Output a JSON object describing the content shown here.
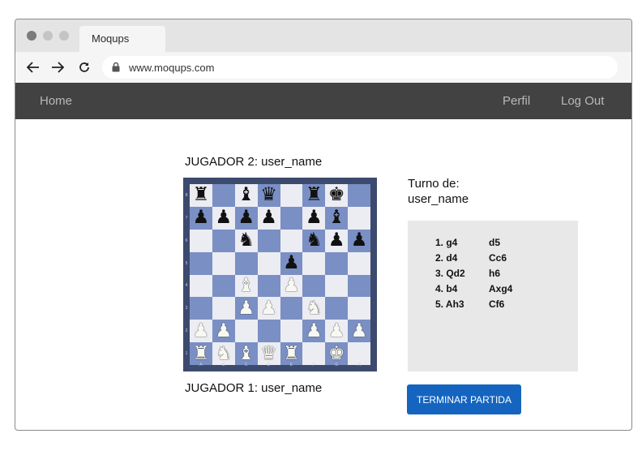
{
  "browser": {
    "tab_title": "Moqups",
    "url": "www.moqups.com",
    "icons": [
      "back-arrow-icon",
      "forward-arrow-icon",
      "reload-icon",
      "lock-icon"
    ]
  },
  "nav": {
    "home": "Home",
    "perfil": "Perfil",
    "logout": "Log Out"
  },
  "game": {
    "player2": "JUGADOR 2: user_name",
    "player1": "JUGADOR 1: user_name",
    "turn_label": "Turno de:",
    "turn_user": "user_name",
    "end_button": "TERMINAR PARTIDA",
    "board_files": [
      "A",
      "B",
      "C",
      "D",
      "E",
      "F",
      "G",
      "H"
    ],
    "board_ranks": [
      "8",
      "7",
      "6",
      "5",
      "4",
      "3",
      "2",
      "1"
    ],
    "board": [
      [
        "r",
        "",
        "b",
        "q",
        "",
        "r",
        "k",
        ""
      ],
      [
        "p",
        "p",
        "p",
        "p",
        "",
        "p",
        "b",
        ""
      ],
      [
        "",
        "",
        "n",
        "",
        "",
        "n",
        "p",
        "p"
      ],
      [
        "",
        "",
        "",
        "",
        "p",
        "",
        "",
        ""
      ],
      [
        "",
        "",
        "B",
        "",
        "P",
        "",
        "",
        ""
      ],
      [
        "",
        "",
        "P",
        "P",
        "",
        "N",
        "",
        ""
      ],
      [
        "P",
        "P",
        "",
        "",
        "",
        "P",
        "P",
        "P"
      ],
      [
        "R",
        "N",
        "B",
        "Q",
        "R",
        "",
        "K",
        ""
      ]
    ],
    "moves": [
      {
        "white": "1. g4",
        "black": "d5"
      },
      {
        "white": "2. d4",
        "black": "Cc6"
      },
      {
        "white": "3. Qd2",
        "black": "h6"
      },
      {
        "white": "4. b4",
        "black": "Axg4"
      },
      {
        "white": "5. Ah3",
        "black": "Cf6"
      }
    ]
  },
  "colors": {
    "nav_bg": "#424242",
    "button_bg": "#1565c0",
    "board_light": "#ececf3",
    "board_dark": "#7a8fc4",
    "moves_panel_bg": "#e8e8e8"
  }
}
